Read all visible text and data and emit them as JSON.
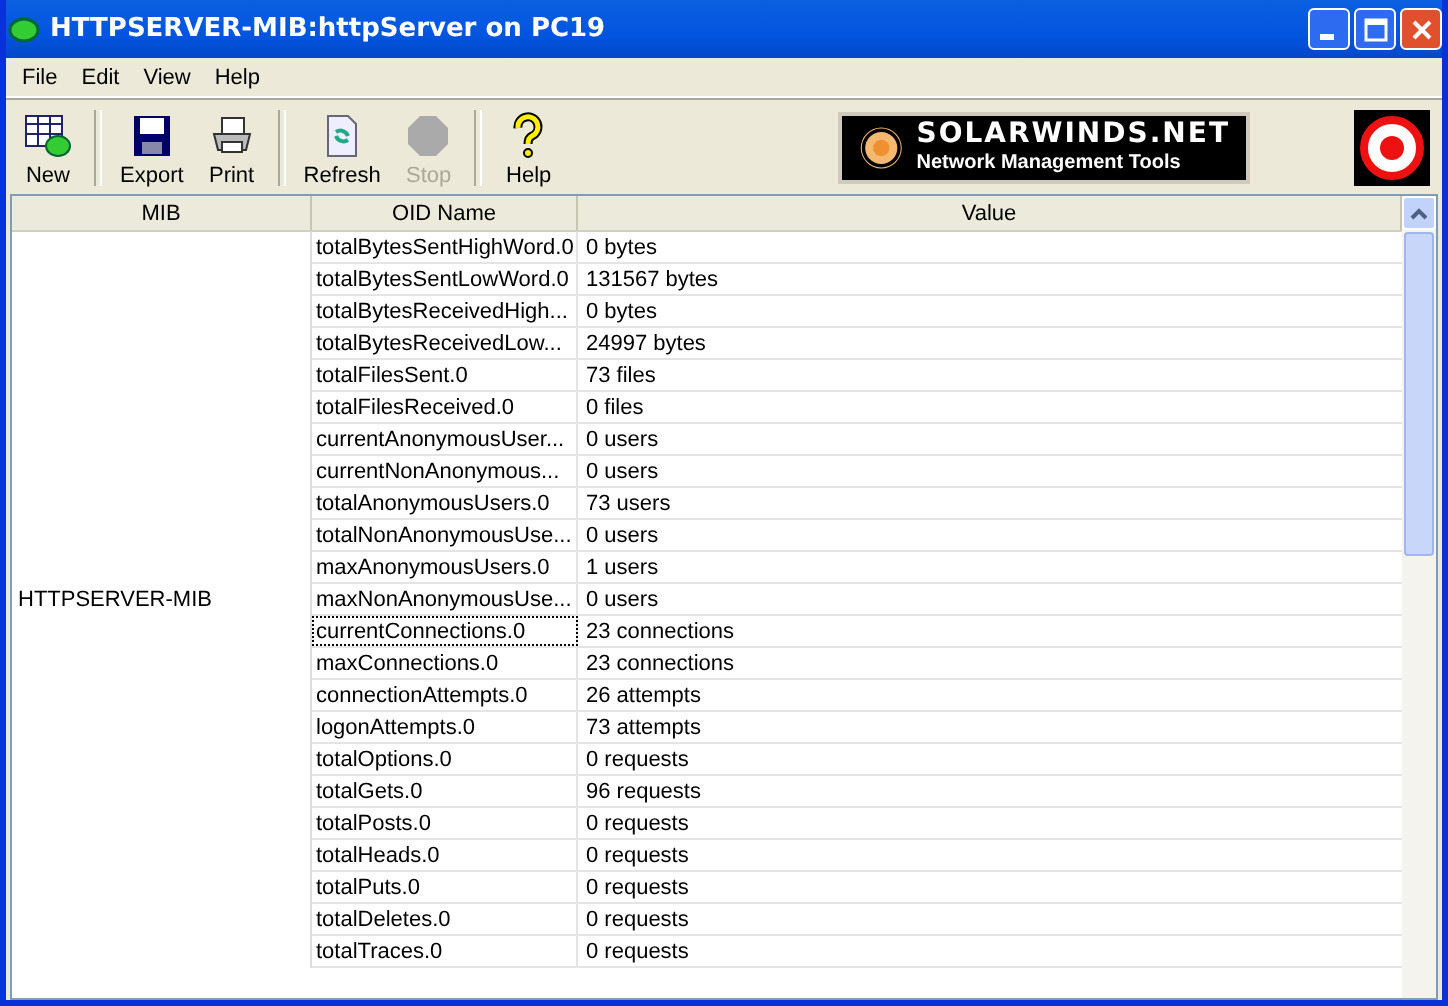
{
  "window": {
    "title": "HTTPSERVER-MIB:httpServer on PC19"
  },
  "menu": [
    "File",
    "Edit",
    "View",
    "Help"
  ],
  "toolbar": [
    {
      "label": "New",
      "kind": "new",
      "disabled": false
    },
    {
      "label": "Export",
      "kind": "export",
      "disabled": false
    },
    {
      "label": "Print",
      "kind": "print",
      "disabled": false
    },
    {
      "label": "Refresh",
      "kind": "refresh",
      "disabled": false
    },
    {
      "label": "Stop",
      "kind": "stop",
      "disabled": true
    },
    {
      "label": "Help",
      "kind": "help",
      "disabled": false
    }
  ],
  "banner": {
    "brand": "SOLARWINDS.NET",
    "tagline": "Network Management Tools"
  },
  "table": {
    "columns": [
      "MIB",
      "OID Name",
      "Value"
    ],
    "mib": "HTTPSERVER-MIB",
    "rows": [
      {
        "name": "totalBytesSentHighWord.0",
        "value": "0 bytes",
        "focused": false
      },
      {
        "name": "totalBytesSentLowWord.0",
        "value": "131567 bytes",
        "focused": false
      },
      {
        "name": "totalBytesReceivedHigh...",
        "value": "0 bytes",
        "focused": false
      },
      {
        "name": "totalBytesReceivedLow...",
        "value": "24997 bytes",
        "focused": false
      },
      {
        "name": "totalFilesSent.0",
        "value": "73 files",
        "focused": false
      },
      {
        "name": "totalFilesReceived.0",
        "value": "0 files",
        "focused": false
      },
      {
        "name": "currentAnonymousUser...",
        "value": "0 users",
        "focused": false
      },
      {
        "name": "currentNonAnonymous...",
        "value": "0 users",
        "focused": false
      },
      {
        "name": "totalAnonymousUsers.0",
        "value": "73 users",
        "focused": false
      },
      {
        "name": "totalNonAnonymousUse...",
        "value": "0 users",
        "focused": false
      },
      {
        "name": "maxAnonymousUsers.0",
        "value": "1 users",
        "focused": false
      },
      {
        "name": "maxNonAnonymousUse...",
        "value": "0 users",
        "focused": false
      },
      {
        "name": "currentConnections.0",
        "value": "23 connections",
        "focused": true
      },
      {
        "name": "maxConnections.0",
        "value": "23 connections",
        "focused": false
      },
      {
        "name": "connectionAttempts.0",
        "value": "26 attempts",
        "focused": false
      },
      {
        "name": "logonAttempts.0",
        "value": "73 attempts",
        "focused": false
      },
      {
        "name": "totalOptions.0",
        "value": "0 requests",
        "focused": false
      },
      {
        "name": "totalGets.0",
        "value": "96 requests",
        "focused": false
      },
      {
        "name": "totalPosts.0",
        "value": "0 requests",
        "focused": false
      },
      {
        "name": "totalHeads.0",
        "value": "0 requests",
        "focused": false
      },
      {
        "name": "totalPuts.0",
        "value": "0 requests",
        "focused": false
      },
      {
        "name": "totalDeletes.0",
        "value": "0 requests",
        "focused": false
      },
      {
        "name": "totalTraces.0",
        "value": "0 requests",
        "focused": false
      }
    ]
  }
}
